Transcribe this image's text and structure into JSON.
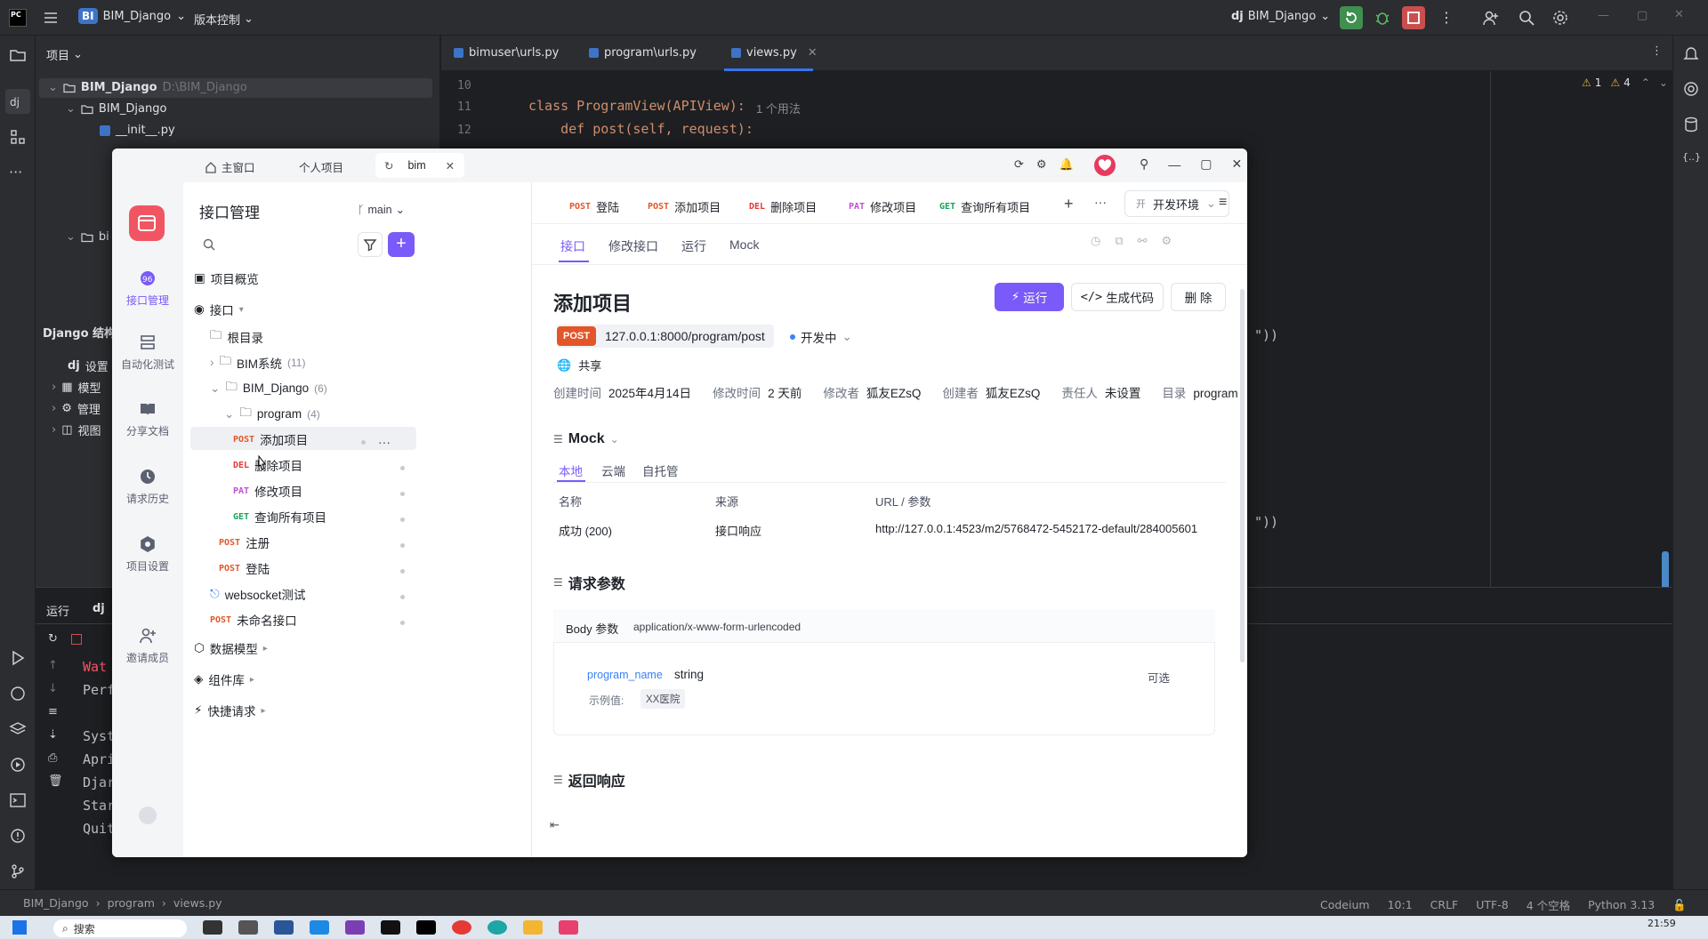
{
  "ide": {
    "project_name": "BIM_Django",
    "project_badge": "BI",
    "vcs_label": "版本控制",
    "run_config": "BIM_Django",
    "run_config_prefix": "dj",
    "project_panel_title": "项目",
    "tree": [
      {
        "label": "BIM_Django",
        "path": "D:\\BIM_Django"
      },
      {
        "label": "BIM_Django"
      },
      {
        "label": "__init__.py"
      },
      {
        "label": "bi"
      }
    ],
    "django_panel_title": "Django 结构",
    "django_items": [
      {
        "prefix": "dj",
        "label": "设置"
      },
      {
        "label": "模型"
      },
      {
        "label": "管理"
      },
      {
        "label": "视图"
      }
    ],
    "tabs": [
      "bimuser\\urls.py",
      "program\\urls.py",
      "views.py"
    ],
    "code_lines": [
      {
        "no": "10",
        "text": ""
      },
      {
        "no": "11",
        "text": "class ProgramView(APIView):",
        "hint": "1 个用法"
      },
      {
        "no": "12",
        "text": "    def post(self, request):"
      }
    ],
    "code_tail_1": "\"))",
    "code_tail_2": "\"))",
    "inspections": {
      "warn1": "1",
      "warn2": "4"
    },
    "run_panel_title": "运行",
    "run_tab_prefix": "dj",
    "console_lines": [
      "Wat",
      "Perf",
      "Syst",
      "Apri",
      "Djar",
      "Star",
      "Quit"
    ],
    "breadcrumb": [
      "BIM_Django",
      "program",
      "views.py"
    ],
    "status": {
      "plugin": "Codeium",
      "position": "10:1",
      "line_sep": "CRLF",
      "encoding": "UTF-8",
      "indent": "4 个空格",
      "interpreter": "Python 3.13"
    },
    "taskbar": {
      "search_placeholder": "搜索",
      "time": "21:59"
    }
  },
  "apifox": {
    "tabs": {
      "home": "主窗口",
      "personal": "个人项目",
      "bim": "bim"
    },
    "rail": [
      {
        "label": "接口管理",
        "icon": "api-icon"
      },
      {
        "label": "自动化测试",
        "icon": "test-icon"
      },
      {
        "label": "分享文档",
        "icon": "book-icon"
      },
      {
        "label": "请求历史",
        "icon": "clock-icon"
      },
      {
        "label": "项目设置",
        "icon": "gear-icon"
      },
      {
        "label": "邀请成员",
        "icon": "add-user-icon"
      }
    ],
    "side": {
      "title": "接口管理",
      "branch": "main",
      "search_placeholder": "",
      "overview": "项目概览",
      "api_root": "接口",
      "root_dir": "根目录",
      "folders": [
        {
          "label": "BIM系统",
          "count": "(11)"
        },
        {
          "label": "BIM_Django",
          "count": "(6)"
        },
        {
          "label": "program",
          "count": "(4)"
        }
      ],
      "endpoints": [
        {
          "method": "POST",
          "label": "添加项目"
        },
        {
          "method": "DEL",
          "label": "删除项目"
        },
        {
          "method": "PAT",
          "label": "修改项目"
        },
        {
          "method": "GET",
          "label": "查询所有项目"
        },
        {
          "method": "POST",
          "label": "注册"
        },
        {
          "method": "POST",
          "label": "登陆"
        }
      ],
      "websocket": "websocket测试",
      "unnamed": {
        "method": "POST",
        "label": "未命名接口"
      },
      "data_model": "数据模型",
      "components": "组件库",
      "quick_request": "快捷请求"
    },
    "req_tabs": [
      {
        "method": "POST",
        "label": "登陆"
      },
      {
        "method": "POST",
        "label": "添加项目"
      },
      {
        "method": "DEL",
        "label": "删除项目"
      },
      {
        "method": "PAT",
        "label": "修改项目"
      },
      {
        "method": "GET",
        "label": "查询所有项目"
      }
    ],
    "env": "开发环境",
    "env_icon_text": "开",
    "sub_tabs": [
      "接口",
      "修改接口",
      "运行",
      "Mock"
    ],
    "title": "添加项目",
    "buttons": {
      "run": "运行",
      "gen_code": "生成代码",
      "delete": "删 除"
    },
    "method": "POST",
    "url": "127.0.0.1:8000/program/post",
    "url_env": "开发中",
    "share": "共享",
    "meta": [
      {
        "k": "创建时间",
        "v": "2025年4月14日"
      },
      {
        "k": "修改时间",
        "v": "2 天前"
      },
      {
        "k": "修改者",
        "v": "狐友EZsQ"
      },
      {
        "k": "创建者",
        "v": "狐友EZsQ"
      },
      {
        "k": "责任人",
        "v": "未设置"
      },
      {
        "k": "目录",
        "v": "program"
      }
    ],
    "mock": {
      "title": "Mock",
      "tabs": [
        "本地",
        "云端",
        "自托管"
      ],
      "headers": [
        "名称",
        "来源",
        "URL / 参数"
      ],
      "row": {
        "name": "成功 (200)",
        "source": "接口响应",
        "url": "http://127.0.0.1:4523/m2/5768472-5452172-default/284005601"
      }
    },
    "params": {
      "title": "请求参数",
      "body_label": "Body 参数",
      "content_type": "application/x-www-form-urlencoded",
      "field": "program_name",
      "type": "string",
      "optional": "可选",
      "example_label": "示例值:",
      "example": "XX医院"
    },
    "response_title": "返回响应"
  }
}
